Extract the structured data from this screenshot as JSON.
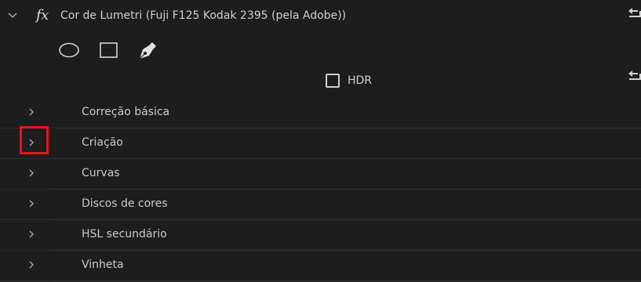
{
  "effect": {
    "fx": "fx",
    "title": "Cor de Lumetri (Fuji F125 Kodak 2395 (pela Adobe))"
  },
  "hdr": {
    "label": "HDR",
    "checked": false
  },
  "sections": [
    {
      "label": "Correção básica"
    },
    {
      "label": "Criação"
    },
    {
      "label": "Curvas"
    },
    {
      "label": "Discos de cores"
    },
    {
      "label": "HSL secundário"
    },
    {
      "label": "Vinheta"
    }
  ],
  "icons": {
    "collapse": "chevron-down-icon",
    "expand": "chevron-right-icon",
    "reset": "reset-icon",
    "ellipse": "ellipse-mask-icon",
    "rect": "rectangle-mask-icon",
    "pen": "pen-mask-icon"
  },
  "colors": {
    "background": "#1d1d1d",
    "text": "#c9c9c9",
    "highlight": "#e8141b"
  }
}
